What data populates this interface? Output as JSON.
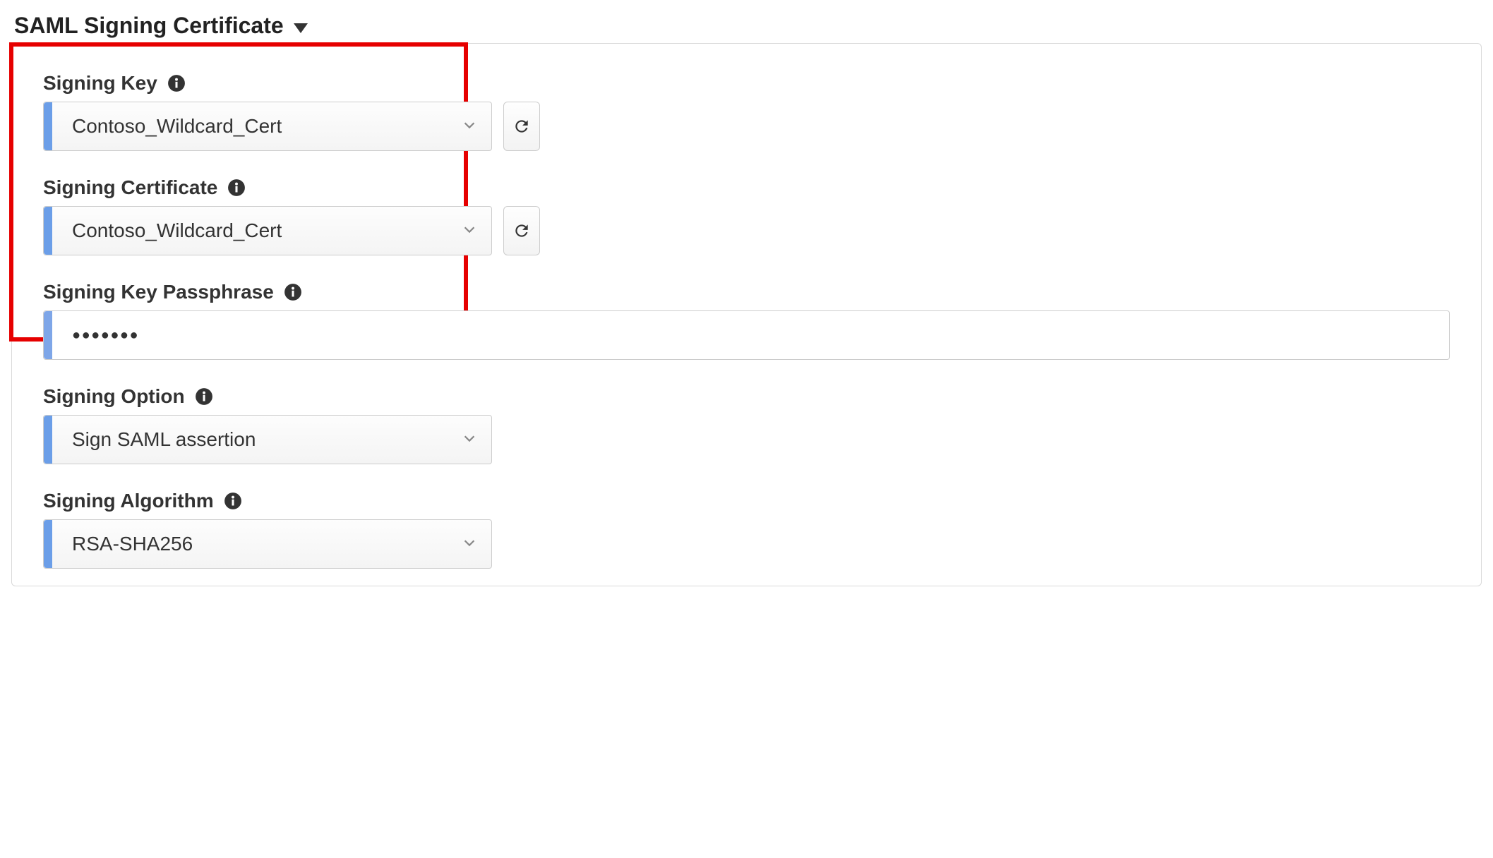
{
  "section": {
    "title": "SAML Signing Certificate"
  },
  "fields": {
    "signing_key": {
      "label": "Signing Key",
      "value": "Contoso_Wildcard_Cert"
    },
    "signing_certificate": {
      "label": "Signing Certificate",
      "value": "Contoso_Wildcard_Cert"
    },
    "signing_key_passphrase": {
      "label": "Signing Key Passphrase",
      "masked_value": "●●●●●●●"
    },
    "signing_option": {
      "label": "Signing Option",
      "value": "Sign SAML assertion"
    },
    "signing_algorithm": {
      "label": "Signing Algorithm",
      "value": "RSA-SHA256"
    }
  }
}
